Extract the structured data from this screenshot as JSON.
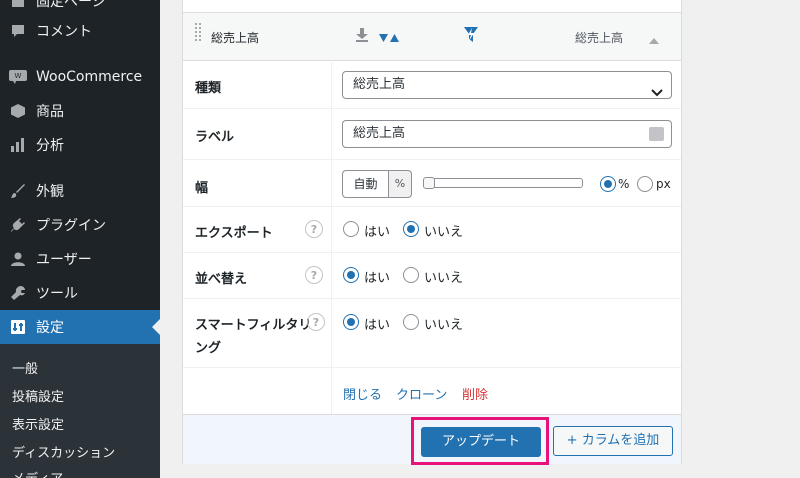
{
  "sidebar": {
    "items": [
      {
        "label": "固定ページ",
        "icon": "page-icon"
      },
      {
        "label": "コメント",
        "icon": "comment-icon"
      },
      {
        "label": "WooCommerce",
        "icon": "woo-icon"
      },
      {
        "label": "商品",
        "icon": "box-icon"
      },
      {
        "label": "分析",
        "icon": "bar-chart-icon"
      },
      {
        "label": "外観",
        "icon": "brush-icon"
      },
      {
        "label": "プラグイン",
        "icon": "plug-icon"
      },
      {
        "label": "ユーザー",
        "icon": "user-icon"
      },
      {
        "label": "ツール",
        "icon": "wrench-icon"
      },
      {
        "label": "設定",
        "icon": "settings-icon"
      }
    ],
    "submenu": [
      "一般",
      "投稿設定",
      "表示設定",
      "ディスカッション",
      "メディア"
    ]
  },
  "column": {
    "title": "総売上高",
    "label_right": "総売上高"
  },
  "fields": {
    "type": {
      "label": "種類",
      "value": "総売上高"
    },
    "label": {
      "label": "ラベル",
      "value": "総売上高"
    },
    "width": {
      "label": "幅",
      "auto": "自動",
      "unit": "%",
      "percent_option": "%",
      "px_option": "px",
      "selected_unit": "%"
    },
    "export": {
      "label": "エクスポート",
      "yes": "はい",
      "no": "いいえ",
      "selected": "no"
    },
    "sort": {
      "label": "並べ替え",
      "yes": "はい",
      "no": "いいえ",
      "selected": "yes"
    },
    "smart_filter": {
      "label": "スマートフィルタリング",
      "label_line1": "スマートフィルタリ",
      "label_line2": "ング",
      "yes": "はい",
      "no": "いいえ",
      "selected": "yes"
    }
  },
  "actions": {
    "close": "閉じる",
    "clone": "クローン",
    "delete": "削除"
  },
  "footer": {
    "update_button": "アップデート",
    "add_column_button": "+ カラムを追加"
  },
  "colors": {
    "primary": "#2271b1",
    "sidebar_bg": "#1d2327",
    "highlight": "#e8127a",
    "danger": "#d63638"
  },
  "help_icon": "?"
}
